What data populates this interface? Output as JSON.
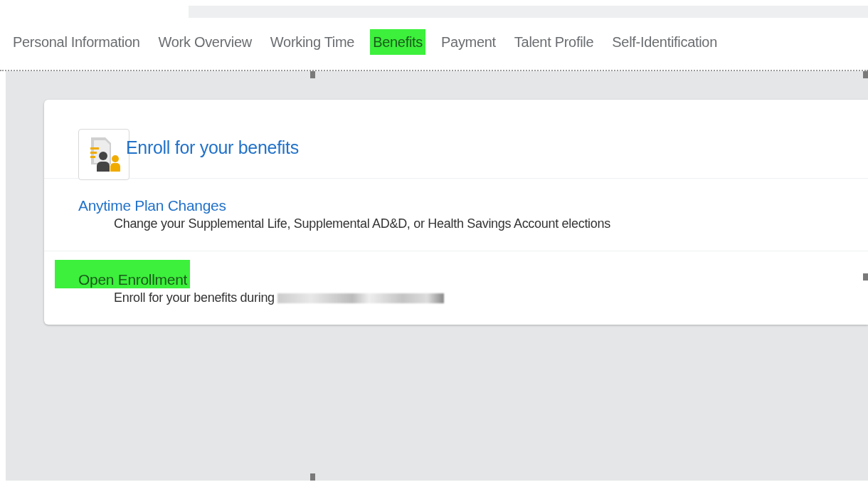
{
  "tabs": [
    {
      "label": "Personal Information",
      "selected": false
    },
    {
      "label": "Work Overview",
      "selected": false
    },
    {
      "label": "Working Time",
      "selected": false
    },
    {
      "label": "Benefits",
      "selected": true
    },
    {
      "label": "Payment",
      "selected": false
    },
    {
      "label": "Talent Profile",
      "selected": false
    },
    {
      "label": "Self-Identification",
      "selected": false
    }
  ],
  "card": {
    "title": "Enroll for your benefits",
    "items": [
      {
        "title": "Anytime Plan Changes",
        "description": "Change your Supplemental Life, Supplemental AD&D, or Health Savings Account elections",
        "highlighted": false,
        "redacted": false
      },
      {
        "title": "Open Enrollment",
        "description": "Enroll for your benefits during",
        "highlighted": true,
        "redacted": true
      }
    ]
  }
}
